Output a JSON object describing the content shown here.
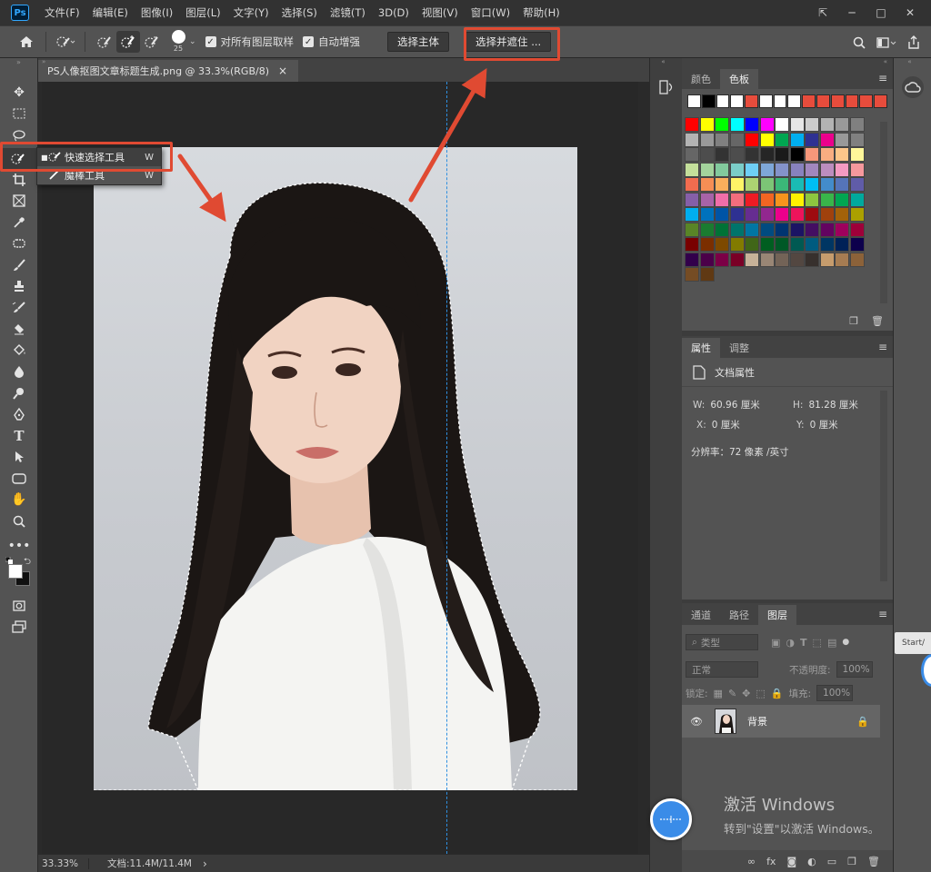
{
  "app": {
    "logo_text": "Ps"
  },
  "menu": {
    "items": [
      "文件(F)",
      "编辑(E)",
      "图像(I)",
      "图层(L)",
      "文字(Y)",
      "选择(S)",
      "滤镜(T)",
      "3D(D)",
      "视图(V)",
      "窗口(W)",
      "帮助(H)"
    ]
  },
  "window_controls": {
    "collapse": "⇱",
    "minimize": "─",
    "maximize": "□",
    "close": "✕"
  },
  "options_bar": {
    "brush_size": "25",
    "sample_all_layers_label": "对所有图层取样",
    "sample_all_layers_checked": true,
    "auto_enhance_label": "自动增强",
    "auto_enhance_checked": true,
    "select_subject_label": "选择主体",
    "select_and_mask_label": "选择并遮住 ..."
  },
  "document": {
    "tab_title": "PS人像抠图文章标题生成.png @ 33.3%(RGB/8)",
    "tab_close": "×"
  },
  "status": {
    "zoom": "33.33%",
    "doc_info": "文档:11.4M/11.4M",
    "arrow": "›"
  },
  "flyout": {
    "items": [
      {
        "label": "快速选择工具",
        "key": "W",
        "selected": true
      },
      {
        "label": "魔棒工具",
        "key": "W",
        "selected": false
      }
    ]
  },
  "swatches_panel": {
    "tabs": [
      "颜色",
      "色板"
    ],
    "active_tab": 1,
    "recent": [
      "#ffffff",
      "#000000",
      "#ffffff",
      "#ffffff",
      "#e74c3c",
      "#ffffff",
      "#ffffff",
      "#ffffff",
      "#e74c3c",
      "#e74c3c",
      "#e74c3c",
      "#e74c3c",
      "#e74c3c",
      "#e74c3c"
    ],
    "grid": [
      "#ff0000",
      "#ffff00",
      "#00ff00",
      "#00ffff",
      "#0000ff",
      "#ff00ff",
      "#ffffff",
      "#e6e6e6",
      "#cccccc",
      "#b3b3b3",
      "#999999",
      "#808080",
      "#b3b3b3",
      "#999999",
      "#808080",
      "#666666",
      "#ff0000",
      "#ffff00",
      "#00a651",
      "#00aeef",
      "#2e3192",
      "#ec008c",
      "#999999",
      "#808080",
      "#666666",
      "#4d4d4d",
      "#333333",
      "#4d4d4d",
      "#333333",
      "#262626",
      "#1a1a1a",
      "#000000",
      "#f7977a",
      "#f9ad81",
      "#fdc68a",
      "#fff79a",
      "#c4df9b",
      "#a3d39c",
      "#82ca9d",
      "#7bcdc8",
      "#6ecff6",
      "#7ea7d8",
      "#8493ca",
      "#8882be",
      "#a187be",
      "#bc8dbf",
      "#f49ac2",
      "#f6989d",
      "#f26c4f",
      "#f68e55",
      "#fbaf5c",
      "#fff467",
      "#acd372",
      "#7cc576",
      "#3bb878",
      "#1abbb4",
      "#00bff3",
      "#438ccb",
      "#5574b9",
      "#605ca8",
      "#855fa8",
      "#a763a8",
      "#f06ea9",
      "#f26d7d",
      "#ed1c24",
      "#f26522",
      "#f7941d",
      "#fff200",
      "#8dc73f",
      "#39b54a",
      "#00a651",
      "#00a99d",
      "#00aeef",
      "#0072bc",
      "#0054a6",
      "#2e3192",
      "#662d91",
      "#92278f",
      "#ec008c",
      "#ed145b",
      "#9e0b0f",
      "#a0410d",
      "#a36209",
      "#aba000",
      "#598527",
      "#1a7b30",
      "#007236",
      "#00746b",
      "#0076a3",
      "#004b80",
      "#003471",
      "#1b1464",
      "#440e62",
      "#630460",
      "#9e005d",
      "#9e0039",
      "#790000",
      "#7b2e00",
      "#7d4900",
      "#827b00",
      "#406618",
      "#005e20",
      "#005826",
      "#005952",
      "#005b7f",
      "#003663",
      "#002157",
      "#0d004c",
      "#32004b",
      "#4b0049",
      "#7b0046",
      "#7a0026",
      "#c7b299",
      "#998675",
      "#736357",
      "#534741",
      "#37302d",
      "#c69c6d",
      "#a67c52",
      "#8c6239",
      "#754c24",
      "#603913"
    ],
    "footer_new": "❐",
    "footer_delete": "🗑"
  },
  "properties_panel": {
    "tabs": [
      "属性",
      "调整"
    ],
    "active_tab": 0,
    "section_title": "文档属性",
    "w_label": "W:",
    "w_value": "60.96 厘米",
    "h_label": "H:",
    "h_value": "81.28 厘米",
    "x_label": "X:",
    "x_value": "0 厘米",
    "y_label": "Y:",
    "y_value": "0 厘米",
    "resolution": "分辨率：72 像素 /英寸"
  },
  "layers_panel": {
    "tabs": [
      "通道",
      "路径",
      "图层"
    ],
    "active_tab": 2,
    "filter_placeholder": "类型",
    "blend_mode": "正常",
    "opacity_label": "不透明度:",
    "opacity_value": "100%",
    "lock_label": "锁定:",
    "fill_label": "填充:",
    "fill_value": "100%",
    "layer_name": "背景",
    "footer_icons": [
      "∞",
      "fx",
      "◙",
      "◐",
      "▭",
      "❐",
      "🗑"
    ]
  },
  "watermark": {
    "title": "激活 Windows",
    "subtitle": "转到\"设置\"以激活 Windows。"
  },
  "start_tab": {
    "label": "Start/"
  },
  "colors": {
    "annotation_red": "#e04a32",
    "guide_blue": "#2e8fe0"
  }
}
